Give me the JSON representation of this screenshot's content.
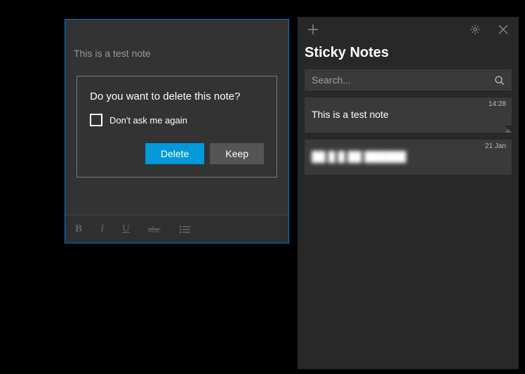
{
  "note": {
    "content": "This is a test note"
  },
  "dialog": {
    "title": "Do you want to delete this note?",
    "dont_ask_label": "Don't ask me again",
    "delete_label": "Delete",
    "keep_label": "Keep"
  },
  "format": {
    "bold": "B",
    "italic": "I",
    "underline": "U",
    "strike": "abc"
  },
  "list": {
    "app_title": "Sticky Notes",
    "search_placeholder": "Search...",
    "items": [
      {
        "preview": "This is a test note",
        "time": "14:28",
        "has_fold": true
      },
      {
        "preview": "██ █ █ ██  ██████",
        "time": "21 Jan",
        "has_fold": false,
        "blurred": true
      }
    ]
  }
}
